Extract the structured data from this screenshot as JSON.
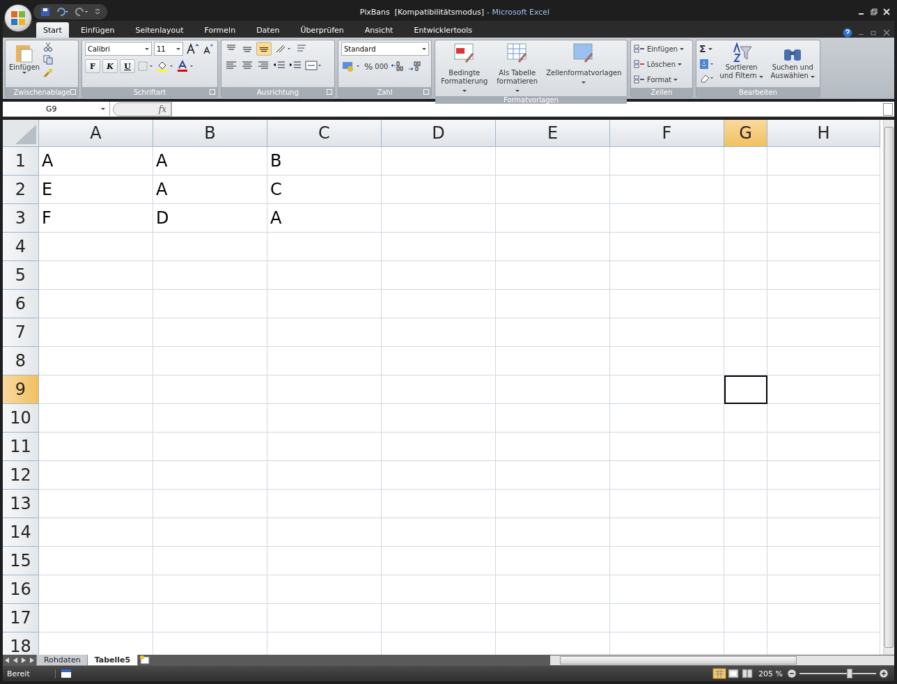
{
  "window": {
    "title": "PixBans  [Kompatibilitätsmodus]",
    "app_name": "- Microsoft Excel"
  },
  "tabs": [
    {
      "label": "Start",
      "selected": true
    },
    {
      "label": "Einfügen",
      "selected": false
    },
    {
      "label": "Seitenlayout",
      "selected": false
    },
    {
      "label": "Formeln",
      "selected": false
    },
    {
      "label": "Daten",
      "selected": false
    },
    {
      "label": "Überprüfen",
      "selected": false
    },
    {
      "label": "Ansicht",
      "selected": false
    },
    {
      "label": "Entwicklertools",
      "selected": false
    }
  ],
  "ribbon": {
    "clipboard": {
      "label": "Zwischenablage",
      "paste": "Einfügen"
    },
    "font": {
      "label": "Schriftart",
      "font_name": "Calibri",
      "font_size": "11",
      "bold": "F",
      "italic": "K",
      "underline": "U"
    },
    "alignment": {
      "label": "Ausrichtung"
    },
    "number": {
      "label": "Zahl",
      "format": "Standard",
      "percent": "%",
      "thousands": "000"
    },
    "styles": {
      "label": "Formatvorlagen",
      "buttons": [
        "Bedingte Formatierung",
        "Als Tabelle formatieren",
        "Zellenformatvorlagen"
      ]
    },
    "cells": {
      "label": "Zellen",
      "buttons": [
        "Einfügen",
        "Löschen",
        "Format"
      ]
    },
    "editing": {
      "label": "Bearbeiten",
      "sum": "Σ",
      "buttons": [
        "Sortieren und Filtern",
        "Suchen und Auswählen"
      ]
    }
  },
  "formula_bar": {
    "name_box": "G9",
    "fx": "fx"
  },
  "columns": [
    {
      "label": "A",
      "selected": false
    },
    {
      "label": "B",
      "selected": false
    },
    {
      "label": "C",
      "selected": false
    },
    {
      "label": "D",
      "selected": false
    },
    {
      "label": "E",
      "selected": false
    },
    {
      "label": "F",
      "selected": false
    },
    {
      "label": "G",
      "selected": true
    },
    {
      "label": "H",
      "selected": false
    }
  ],
  "rows": [
    {
      "label": "1",
      "selected": false,
      "cells": [
        "A",
        "A",
        "B"
      ]
    },
    {
      "label": "2",
      "selected": false,
      "cells": [
        "E",
        "A",
        "C"
      ]
    },
    {
      "label": "3",
      "selected": false,
      "cells": [
        "F",
        "D",
        "A"
      ]
    },
    {
      "label": "4",
      "selected": false
    },
    {
      "label": "5",
      "selected": false
    },
    {
      "label": "6",
      "selected": false
    },
    {
      "label": "7",
      "selected": false
    },
    {
      "label": "8",
      "selected": false
    },
    {
      "label": "9",
      "selected": true
    },
    {
      "label": "10",
      "selected": false
    },
    {
      "label": "11",
      "selected": false
    },
    {
      "label": "12",
      "selected": false
    },
    {
      "label": "13",
      "selected": false
    },
    {
      "label": "14",
      "selected": false
    },
    {
      "label": "15",
      "selected": false
    },
    {
      "label": "16",
      "selected": false
    },
    {
      "label": "17",
      "selected": false
    },
    {
      "label": "18",
      "selected": false
    }
  ],
  "sheet_tabs": [
    {
      "label": "Rohdaten",
      "selected": false
    },
    {
      "label": "Tabelle5",
      "selected": true
    }
  ],
  "status_bar": {
    "status": "Bereit",
    "zoom": "205 %",
    "zoom_level": {
      "level": 0.65
    }
  }
}
